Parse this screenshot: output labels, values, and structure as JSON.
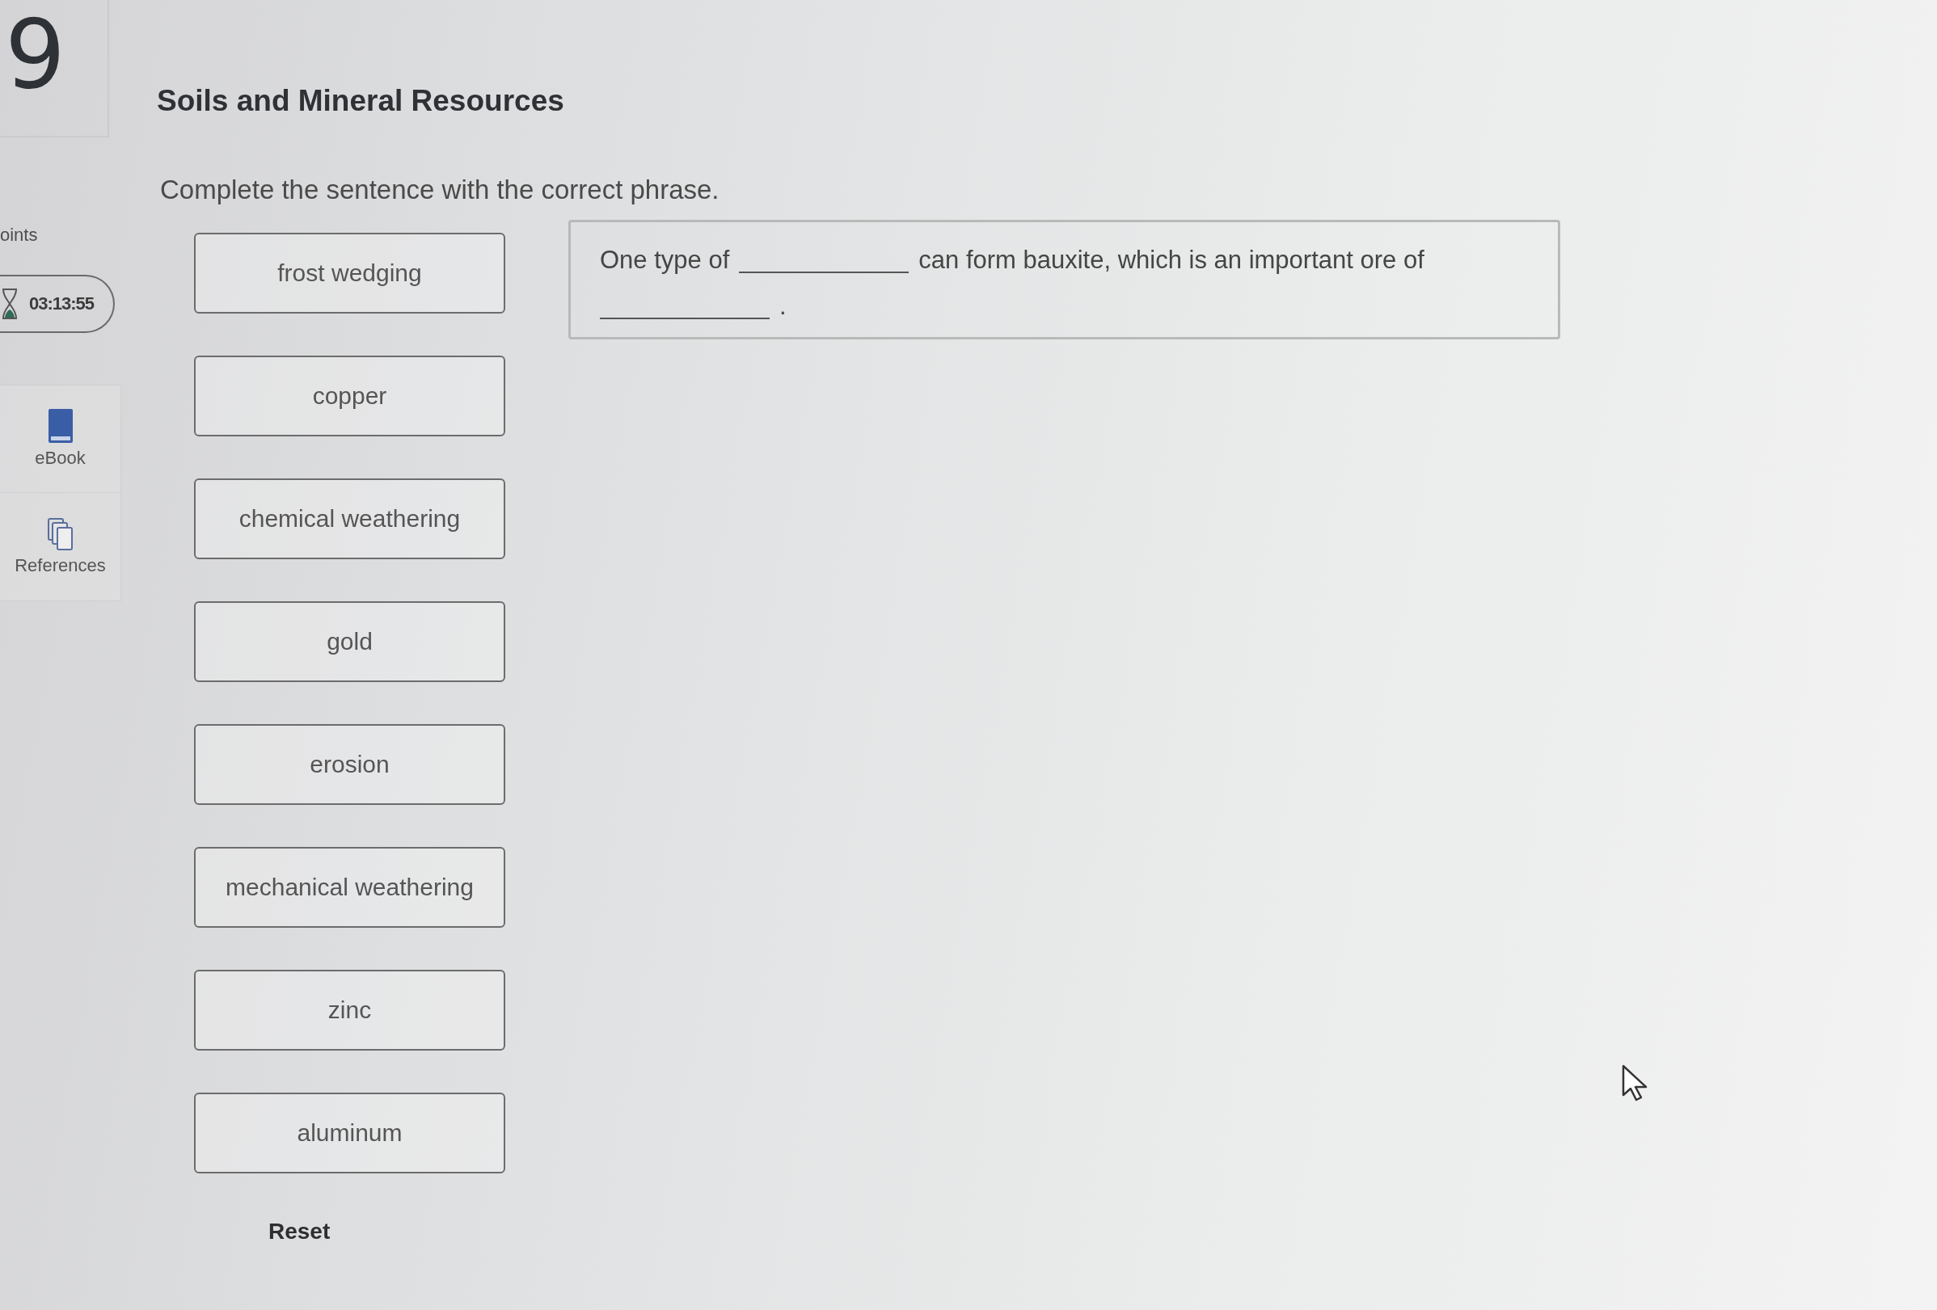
{
  "question_number": "9",
  "sidebar": {
    "points_label": "oints",
    "timer": "03:13:55",
    "tools": [
      {
        "kind": "ebook",
        "label": "eBook"
      },
      {
        "kind": "references",
        "label": "References"
      }
    ]
  },
  "title": "Soils and Mineral Resources",
  "instruction": "Complete the sentence with the correct phrase.",
  "options": [
    "frost wedging",
    "copper",
    "chemical weathering",
    "gold",
    "erosion",
    "mechanical weathering",
    "zinc",
    "aluminum"
  ],
  "sentence": [
    {
      "kind": "text",
      "text": "One type of"
    },
    {
      "kind": "blank"
    },
    {
      "kind": "text",
      "text": "can form bauxite, which is an important ore of"
    },
    {
      "kind": "blank"
    },
    {
      "kind": "text",
      "text": "."
    }
  ],
  "reset_label": "Reset"
}
